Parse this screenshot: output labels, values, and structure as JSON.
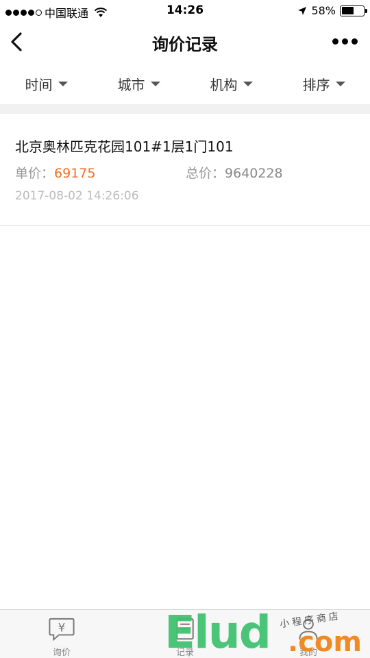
{
  "status": {
    "carrier": "中国联通",
    "time": "14:26",
    "battery": "58%",
    "battery_level": 0.58
  },
  "nav": {
    "title": "询价记录"
  },
  "filters": [
    {
      "label": "时间"
    },
    {
      "label": "城市"
    },
    {
      "label": "机构"
    },
    {
      "label": "排序"
    }
  ],
  "records": [
    {
      "title": "北京奥林匹克花园101#1层1门101",
      "unit_price_label": "单价：",
      "unit_price": "69175",
      "total_price_label": "总价：",
      "total_price": "9640228",
      "time": "2017-08-02 14:26:06"
    }
  ],
  "tabs": [
    {
      "label": "询价",
      "icon": "yuan-chat-icon"
    },
    {
      "label": "记录",
      "icon": "record-icon"
    },
    {
      "label": "我的",
      "icon": "user-icon"
    }
  ],
  "watermark": {
    "text": "Elud",
    "com": ".com",
    "sub": "小程序商店"
  },
  "colors": {
    "accent_price": "#f26d21",
    "wm_green": "#3cc06d",
    "wm_orange": "#f08a24"
  }
}
